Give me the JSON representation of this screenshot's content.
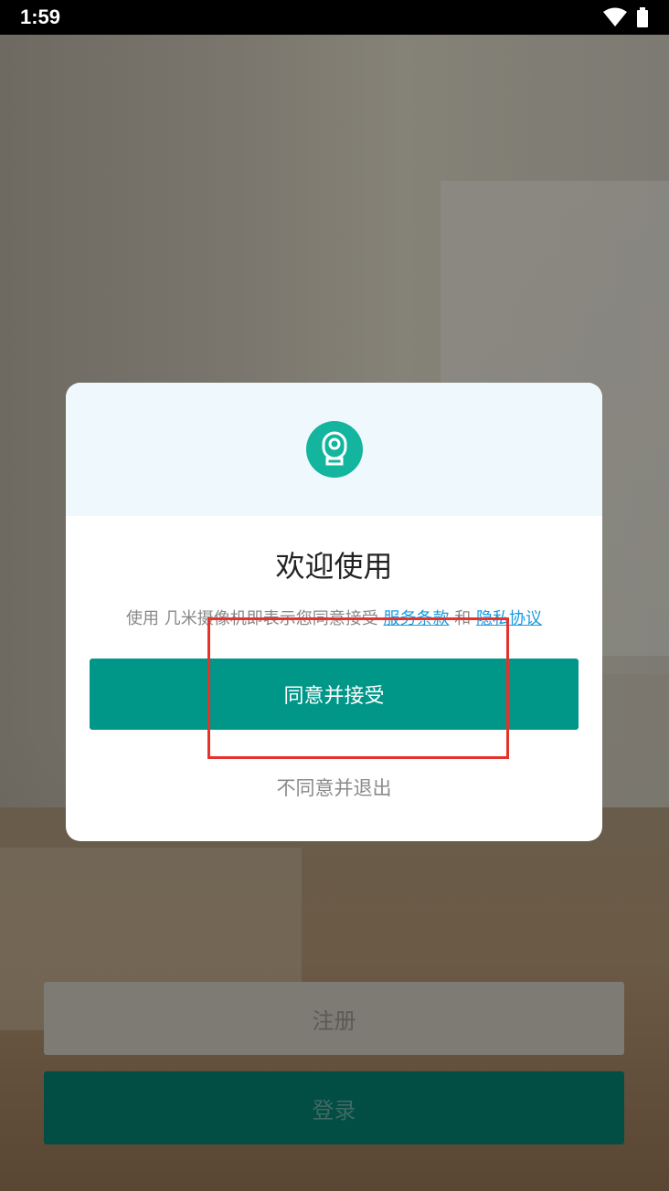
{
  "status_bar": {
    "time": "1:59"
  },
  "dialog": {
    "title": "欢迎使用",
    "description_prefix": "使用 几米摄像机即表示您同意接受",
    "terms_link": "服务条款",
    "description_and": "和",
    "privacy_link": "隐私协议",
    "agree_button": "同意并接受",
    "disagree_button": "不同意并退出"
  },
  "main": {
    "register_button": "注册",
    "login_button": "登录"
  },
  "colors": {
    "accent": "#009688",
    "logo": "#13b59f",
    "link": "#1a9be0",
    "highlight": "#e5322d"
  },
  "icons": [
    "wifi-icon",
    "battery-icon",
    "camera-logo-icon"
  ]
}
